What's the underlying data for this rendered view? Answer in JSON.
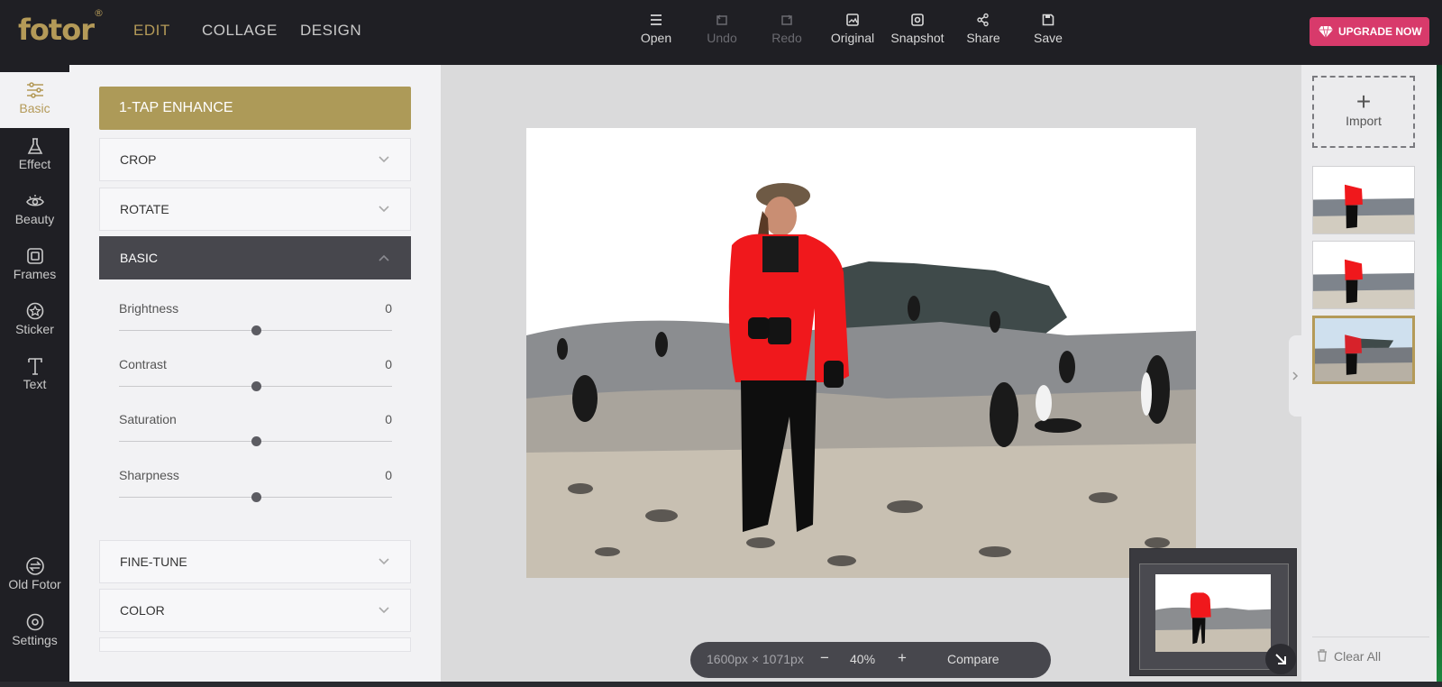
{
  "brand": {
    "name": "fotor",
    "mark": "®"
  },
  "modes": [
    "EDIT",
    "COLLAGE",
    "DESIGN"
  ],
  "toolbar": {
    "open": "Open",
    "undo": "Undo",
    "redo": "Redo",
    "original": "Original",
    "snapshot": "Snapshot",
    "share": "Share",
    "save": "Save"
  },
  "upgrade": "UPGRADE NOW",
  "sidebar": {
    "items": [
      "Basic",
      "Effect",
      "Beauty",
      "Frames",
      "Sticker",
      "Text"
    ],
    "bottom": [
      "Old Fotor",
      "Settings"
    ]
  },
  "panel": {
    "enhance": "1-TAP ENHANCE",
    "sections": [
      "CROP",
      "ROTATE",
      "BASIC",
      "FINE-TUNE",
      "COLOR"
    ],
    "sliders": [
      {
        "label": "Brightness",
        "value": "0",
        "position": 0.5
      },
      {
        "label": "Contrast",
        "value": "0",
        "position": 0.5
      },
      {
        "label": "Saturation",
        "value": "0",
        "position": 0.5
      },
      {
        "label": "Sharpness",
        "value": "0",
        "position": 0.5
      }
    ]
  },
  "canvas": {
    "dimensions": "1600px × 1071px",
    "zoom_out": "−",
    "zoom": "40%",
    "zoom_in": "+",
    "compare": "Compare"
  },
  "history": {
    "import": "Import",
    "plus": "+",
    "clear_all": "Clear All"
  },
  "colors": {
    "accent": "#b49a58",
    "upgrade": "#d83a6b",
    "jacket": "#f0181c"
  }
}
